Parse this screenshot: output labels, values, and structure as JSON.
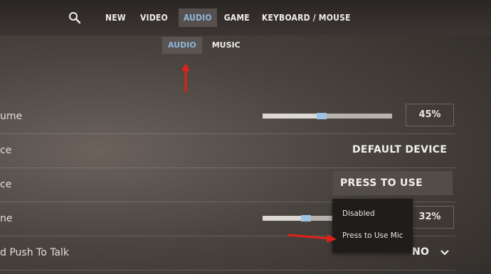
{
  "nav": {
    "items": [
      {
        "label": "NEW"
      },
      {
        "label": "VIDEO"
      },
      {
        "label": "AUDIO",
        "active": true
      },
      {
        "label": "GAME"
      },
      {
        "label": "KEYBOARD / MOUSE"
      }
    ]
  },
  "subnav": {
    "items": [
      {
        "label": "AUDIO",
        "active": true
      },
      {
        "label": "MUSIC"
      }
    ]
  },
  "rows": [
    {
      "label": "ume",
      "type": "slider",
      "value": 45,
      "display": "45%"
    },
    {
      "label": "ce",
      "type": "dropdown",
      "value": "DEFAULT DEVICE"
    },
    {
      "label": "ce",
      "type": "dropdown",
      "value": "PRESS TO USE MIC",
      "open": true
    },
    {
      "label": "ne",
      "type": "slider",
      "value": 32,
      "display": "32%"
    },
    {
      "label": "d Push To Talk",
      "type": "dropdown",
      "value": "NO"
    }
  ],
  "mic_menu": {
    "options": [
      "Disabled",
      "Press to Use Mic"
    ]
  },
  "colors": {
    "accent": "#8fb6d9",
    "annotation": "#e0201b"
  },
  "icons": [
    "search-icon",
    "chevron-down-icon"
  ]
}
